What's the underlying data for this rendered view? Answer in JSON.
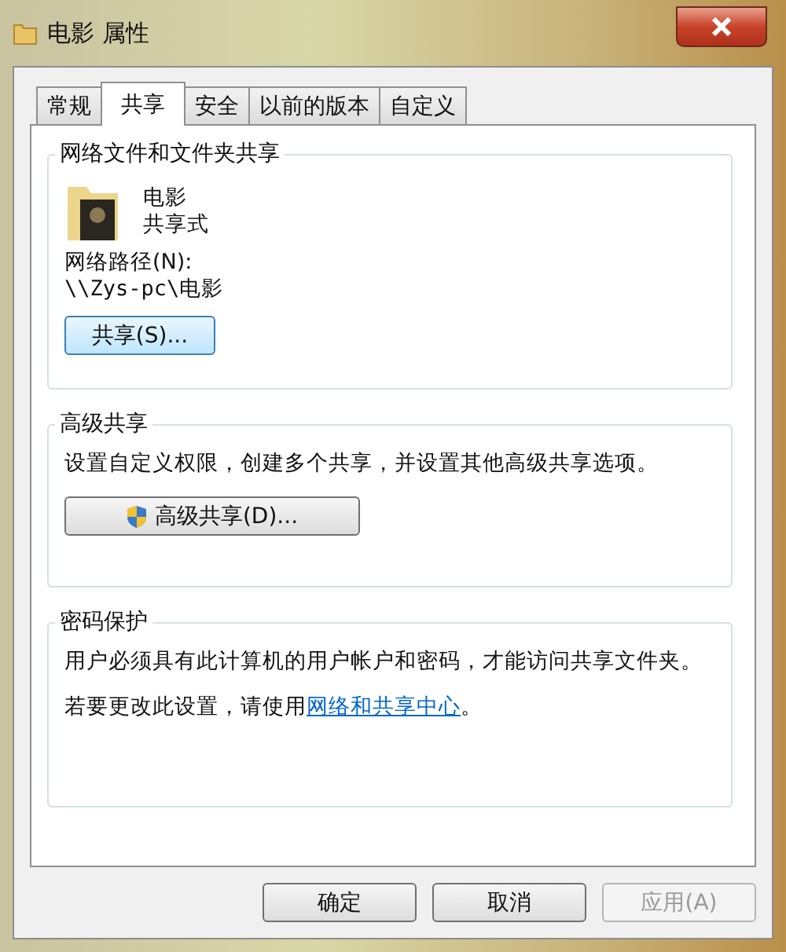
{
  "window": {
    "title": "电影 属性"
  },
  "tabs": [
    {
      "label": "常规",
      "selected": false
    },
    {
      "label": "共享",
      "selected": true
    },
    {
      "label": "安全",
      "selected": false
    },
    {
      "label": "以前的版本",
      "selected": false
    },
    {
      "label": "自定义",
      "selected": false
    }
  ],
  "network_sharing": {
    "title": "网络文件和文件夹共享",
    "folder_name": "电影",
    "share_state": "共享式",
    "path_label": "网络路径(N):",
    "path": "\\\\Zys-pc\\电影",
    "button": "共享(S)..."
  },
  "advanced_sharing": {
    "title": "高级共享",
    "description": "设置自定义权限，创建多个共享，并设置其他高级共享选项。",
    "button": "高级共享(D)..."
  },
  "password_protection": {
    "title": "密码保护",
    "description": "用户必须具有此计算机的用户帐户和密码，才能访问共享文件夹。",
    "change_text": "若要更改此设置，请使用",
    "link": "网络和共享中心",
    "after_link": "。"
  },
  "buttons": [
    {
      "label": "确定",
      "disabled": false
    },
    {
      "label": "取消",
      "disabled": false
    },
    {
      "label": "应用(A)",
      "disabled": true
    }
  ]
}
